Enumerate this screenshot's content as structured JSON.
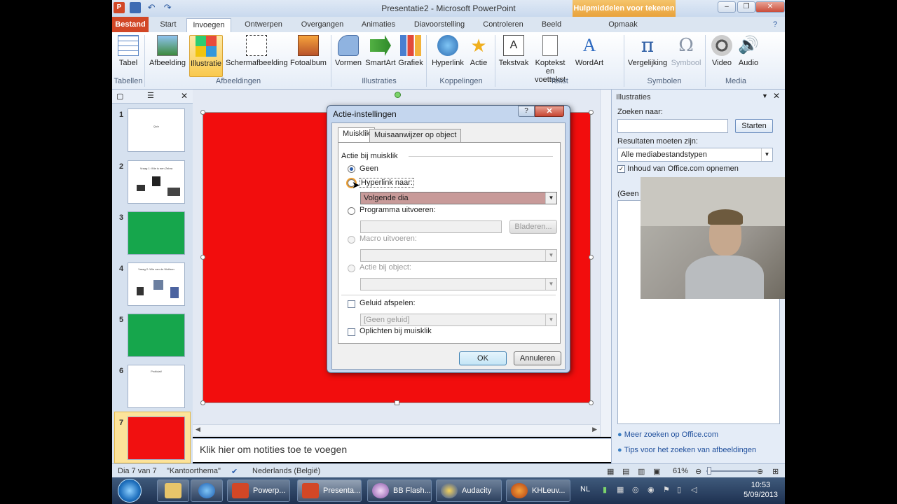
{
  "window": {
    "title": "Presentatie2 - Microsoft PowerPoint",
    "contextual_tab": "Hulpmiddelen voor tekenen"
  },
  "tabs": [
    "Bestand",
    "Start",
    "Invoegen",
    "Ontwerpen",
    "Overgangen",
    "Animaties",
    "Diavoorstelling",
    "Controleren",
    "Beeld",
    "Opmaak"
  ],
  "ribbon": {
    "buttons": {
      "tabel": "Tabel",
      "afbeelding": "Afbeelding",
      "illustratie": "Illustratie",
      "schermafbeelding": "Schermafbeelding",
      "fotoalbum": "Fotoalbum",
      "vormen": "Vormen",
      "smartart": "SmartArt",
      "grafiek": "Grafiek",
      "hyperlink": "Hyperlink",
      "actie": "Actie",
      "tekstvak": "Tekstvak",
      "koptekst": "Koptekst en voettekst",
      "wordart": "WordArt",
      "vergelijking": "Vergelijking",
      "symbool": "Symbool",
      "video": "Video",
      "audio": "Audio"
    },
    "groups": {
      "tabellen": "Tabellen",
      "afbeeldingen": "Afbeeldingen",
      "illustraties": "Illustraties",
      "koppelingen": "Koppelingen",
      "tekst": "Tekst",
      "symbolen": "Symbolen",
      "media": "Media"
    }
  },
  "slides": [
    {
      "num": "1",
      "text": "Quiz"
    },
    {
      "num": "2",
      "text": "Vraag 1: Wie is een Zebra"
    },
    {
      "num": "3",
      "text": ""
    },
    {
      "num": "4",
      "text": "Vraag 2: Wie van de Wolfsen"
    },
    {
      "num": "5",
      "text": ""
    },
    {
      "num": "6",
      "text": "Proficiat!"
    },
    {
      "num": "7",
      "text": ""
    }
  ],
  "notes_placeholder": "Klik hier om notities toe te voegen",
  "taskpane": {
    "title": "Illustraties",
    "search_label": "Zoeken naar:",
    "start_button": "Starten",
    "results_label": "Resultaten moeten zijn:",
    "media_type": "Alle mediabestandstypen",
    "include_office": "Inhoud van Office.com opnemen",
    "results_text": "(Geen r",
    "link_more": "Meer zoeken op Office.com",
    "link_tips": "Tips voor het zoeken van afbeeldingen"
  },
  "status": {
    "slide": "Dia 7 van 7",
    "theme": "\"Kantoorthema\"",
    "language": "Nederlands (België)",
    "zoom": "61%"
  },
  "taskbar": {
    "items": [
      "Powerp...",
      "Presenta...",
      "BB Flash...",
      "Audacity",
      "KHLeuv..."
    ],
    "lang": "NL",
    "time": "10:53",
    "date": "5/09/2013"
  },
  "dialog": {
    "title": "Actie-instellingen",
    "tabs": [
      "Muisklik",
      "Muisaanwijzer op object"
    ],
    "section": "Actie bij muisklik",
    "opt_none": "Geen",
    "opt_hyperlink": "Hyperlink naar:",
    "hyperlink_value": "Volgende dia",
    "opt_program": "Programma uitvoeren:",
    "browse": "Bladeren...",
    "opt_macro": "Macro uitvoeren:",
    "opt_object": "Actie bij object:",
    "sound_label": "Geluid afspelen:",
    "sound_value": "[Geen geluid]",
    "highlight": "Oplichten bij muisklik",
    "ok": "OK",
    "cancel": "Annuleren"
  },
  "colors": {
    "slide_red": "#f20d0d",
    "slide_green": "#16a64c",
    "accent_file_tab": "#d24726"
  }
}
